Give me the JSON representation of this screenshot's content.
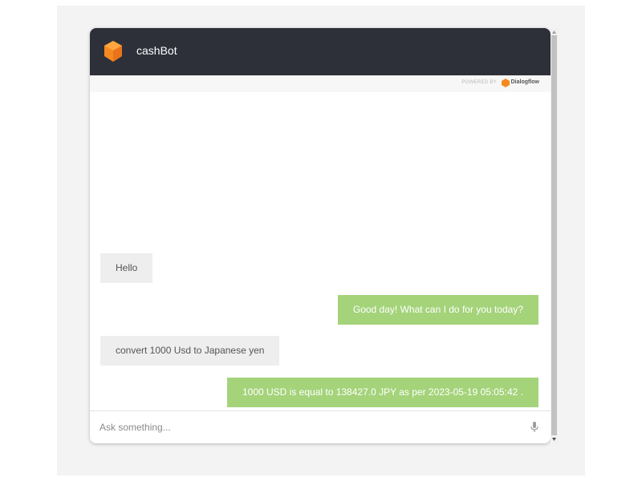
{
  "header": {
    "bot_name": "cashBot"
  },
  "powered_by": {
    "label": "POWERED BY",
    "brand": "Dialogflow"
  },
  "messages": [
    {
      "sender": "user",
      "text": "Hello"
    },
    {
      "sender": "bot",
      "text": "Good day! What can I do for you today?"
    },
    {
      "sender": "user",
      "text": "convert 1000 Usd to Japanese yen"
    },
    {
      "sender": "bot",
      "text": "1000 USD is equal to 138427.0 JPY as per 2023-05-19 05:05:42 ."
    }
  ],
  "input": {
    "placeholder": "Ask something...",
    "value": ""
  },
  "icons": {
    "bot_logo": "dialogflow-cube-icon",
    "mic": "microphone-icon"
  },
  "colors": {
    "header_bg": "#2d3038",
    "bot_bubble": "#a4d37a",
    "user_bubble": "#eeeeee",
    "logo_orange": "#f5891f"
  }
}
